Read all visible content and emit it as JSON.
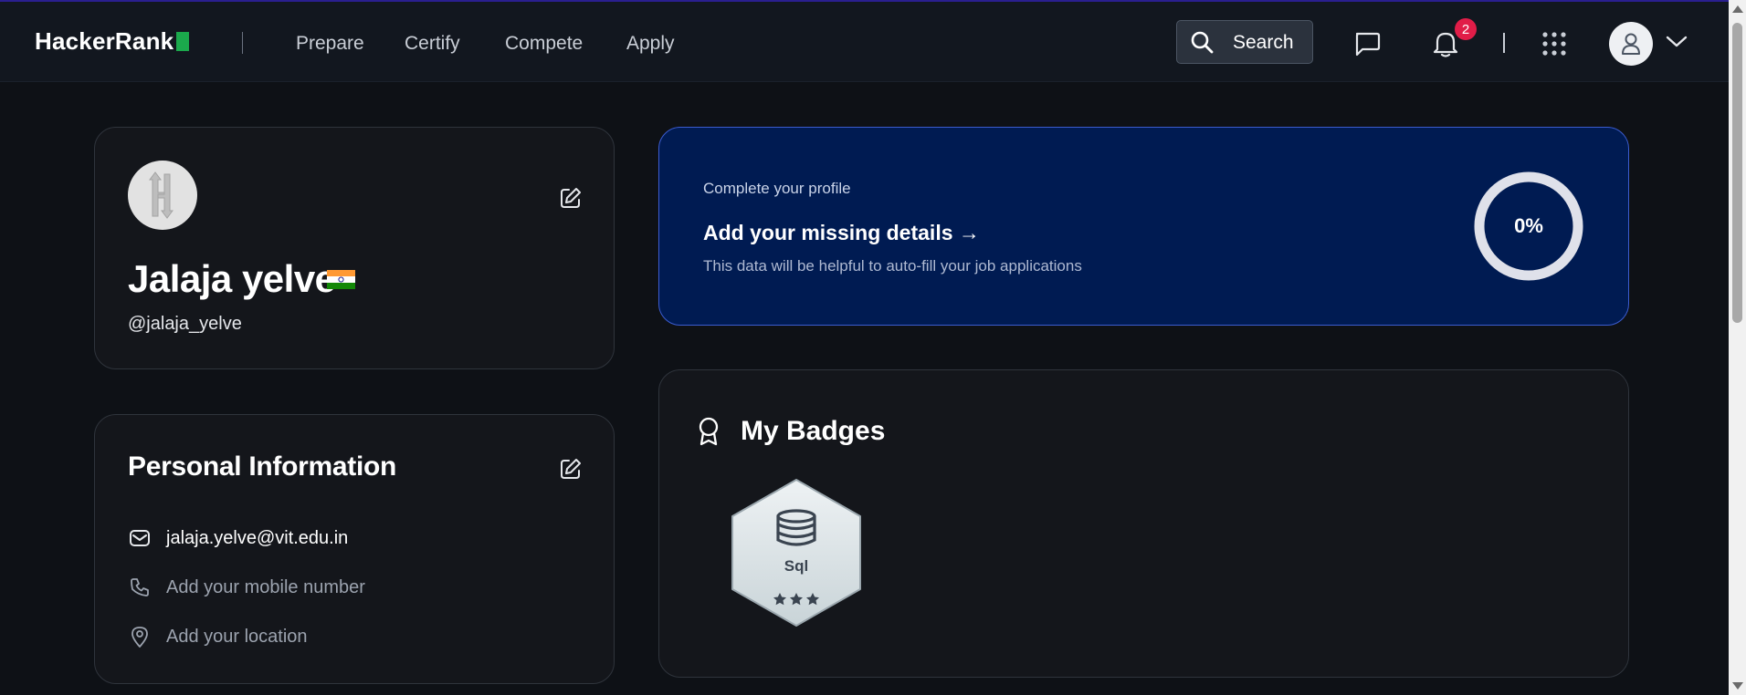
{
  "nav": {
    "logo_text": "HackerRank",
    "links": [
      "Prepare",
      "Certify",
      "Compete",
      "Apply"
    ],
    "search_label": "Search",
    "notification_count": "2"
  },
  "profile": {
    "name": "Jalaja yelve",
    "handle": "@jalaja_yelve"
  },
  "personal_info": {
    "title": "Personal Information",
    "email": "jalaja.yelve@vit.edu.in",
    "mobile_placeholder": "Add your mobile number",
    "location_placeholder": "Add your location"
  },
  "complete_profile": {
    "subtitle": "Complete your profile",
    "title": "Add your missing details →",
    "description": "This data will be helpful to auto-fill your job applications",
    "percent_label": "0%",
    "percent_value": 0
  },
  "badges": {
    "title": "My Badges",
    "items": [
      {
        "label": "Sql",
        "stars": 3
      }
    ]
  },
  "colors": {
    "background": "#0e1116",
    "card": "#14161b",
    "accent_green": "#1ba94c",
    "complete_card_bg": "#001b52",
    "notification_red": "#e11d48"
  },
  "icons": [
    "search-icon",
    "chat-icon",
    "bell-icon",
    "apps-grid-icon",
    "user-icon",
    "chevron-down-icon",
    "edit-icon",
    "mail-icon",
    "phone-icon",
    "location-pin-icon",
    "award-icon",
    "database-icon",
    "star-icon"
  ]
}
